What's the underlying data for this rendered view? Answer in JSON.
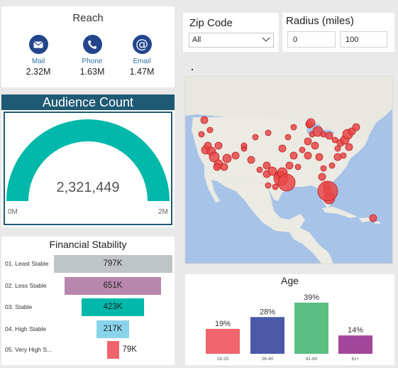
{
  "reach": {
    "title": "Reach",
    "items": [
      {
        "label": "Mail",
        "value": "2.32M",
        "icon": "mail-icon"
      },
      {
        "label": "Phone",
        "value": "1.63M",
        "icon": "phone-icon"
      },
      {
        "label": "Email",
        "value": "1.47M",
        "icon": "email-at-icon"
      }
    ],
    "icon_color": "#23458c"
  },
  "zip": {
    "label": "Zip Code",
    "selected": "All"
  },
  "radius": {
    "label": "Radius (miles)",
    "min": "0",
    "max": "100"
  },
  "audience": {
    "title": "Audience Count",
    "value": "2,321,449",
    "min_label": "0M",
    "max_label": "2M",
    "gauge_fraction": 1.0,
    "gauge_color": "#01b8aa",
    "header_color": "#1f5a74"
  },
  "financial": {
    "title": "Financial Stability",
    "rows": [
      {
        "label": "01. Least Stable",
        "value": "797K",
        "amount": 797,
        "color": "#bfc4c4"
      },
      {
        "label": "02. Less Stable",
        "value": "651K",
        "amount": 651,
        "color": "#b887ad"
      },
      {
        "label": "03. Stable",
        "value": "423K",
        "amount": 423,
        "color": "#01b8aa"
      },
      {
        "label": "04. High Stable",
        "value": "217K",
        "amount": 217,
        "color": "#8ad4eb"
      },
      {
        "label": "05. Very High S...",
        "value": "79K",
        "amount": 79,
        "color": "#f0646e"
      }
    ]
  },
  "age": {
    "title": "Age",
    "categories": [
      "18-25",
      "26-40",
      "41-60",
      "61+"
    ],
    "values": [
      19,
      28,
      39,
      14
    ],
    "labels": [
      "19%",
      "28%",
      "39%",
      "14%"
    ],
    "colors": [
      "#f0646e",
      "#4a5aa8",
      "#5bbf82",
      "#a4459c"
    ]
  },
  "map": {
    "land_color": "#e9e8e2",
    "water_color": "#a7c3e8",
    "marker_color": "#e84848"
  }
}
